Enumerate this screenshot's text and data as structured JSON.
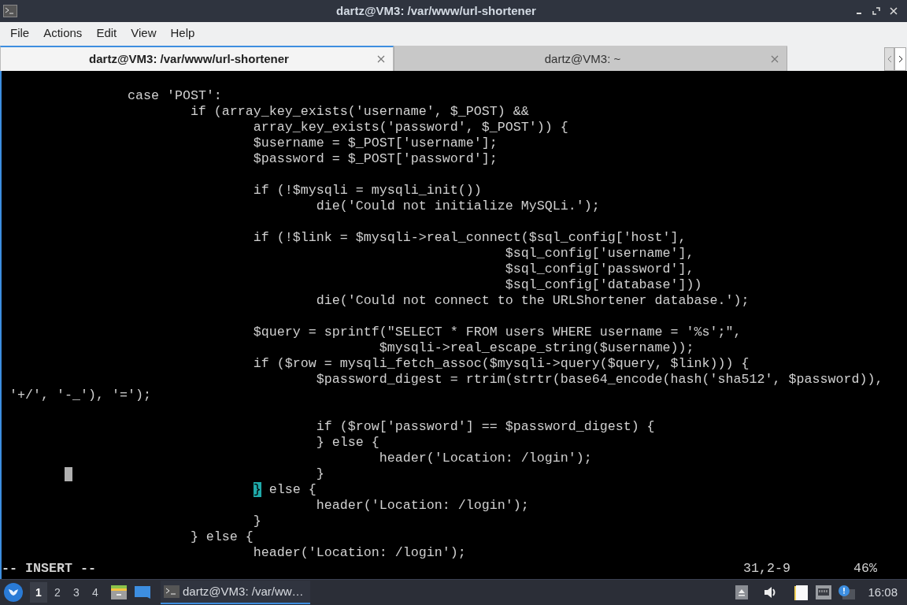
{
  "window": {
    "title": "dartz@VM3: /var/www/url-shortener"
  },
  "menu": [
    "File",
    "Actions",
    "Edit",
    "View",
    "Help"
  ],
  "tabs": [
    {
      "label": "dartz@VM3: /var/www/url-shortener",
      "selected": true
    },
    {
      "label": "dartz@VM3: ~",
      "selected": false
    }
  ],
  "terminal": {
    "lines": [
      {
        "kind": "blank"
      },
      {
        "kind": "text",
        "text": "                case 'POST':"
      },
      {
        "kind": "text",
        "text": "                        if (array_key_exists('username', $_POST) &&"
      },
      {
        "kind": "text",
        "text": "                                array_key_exists('password', $_POST')) {"
      },
      {
        "kind": "text",
        "text": "                                $username = $_POST['username'];"
      },
      {
        "kind": "text",
        "text": "                                $password = $_POST['password'];"
      },
      {
        "kind": "blank"
      },
      {
        "kind": "text",
        "text": "                                if (!$mysqli = mysqli_init())"
      },
      {
        "kind": "text",
        "text": "                                        die('Could not initialize MySQLi.');"
      },
      {
        "kind": "blank"
      },
      {
        "kind": "text",
        "text": "                                if (!$link = $mysqli->real_connect($sql_config['host'],"
      },
      {
        "kind": "text",
        "text": "                                                                $sql_config['username'],"
      },
      {
        "kind": "text",
        "text": "                                                                $sql_config['password'],"
      },
      {
        "kind": "text",
        "text": "                                                                $sql_config['database']))"
      },
      {
        "kind": "text",
        "text": "                                        die('Could not connect to the URLShortener database.');"
      },
      {
        "kind": "blank"
      },
      {
        "kind": "text",
        "text": "                                $query = sprintf(\"SELECT * FROM users WHERE username = '%s';\","
      },
      {
        "kind": "text",
        "text": "                                                $mysqli->real_escape_string($username));"
      },
      {
        "kind": "text",
        "text": "                                if ($row = mysqli_fetch_assoc($mysqli->query($query, $link))) {"
      },
      {
        "kind": "text",
        "text": "                                        $password_digest = rtrim(strtr(base64_encode(hash('sha512', $password)),"
      },
      {
        "kind": "text",
        "text": " '+/', '-_'), '=');"
      },
      {
        "kind": "blank"
      },
      {
        "kind": "text",
        "text": "                                        if ($row['password'] == $password_digest) {"
      },
      {
        "kind": "text",
        "text": "                                        } else {"
      },
      {
        "kind": "text",
        "text": "                                                header('Location: /login');"
      },
      {
        "kind": "text",
        "text": "                                        }",
        "cursor": true
      },
      {
        "kind": "text",
        "text": "                                } else {",
        "bracket_match": true
      },
      {
        "kind": "text",
        "text": "                                        header('Location: /login');"
      },
      {
        "kind": "text",
        "text": "                                }"
      },
      {
        "kind": "text",
        "text": "                        } else {"
      },
      {
        "kind": "text",
        "text": "                                header('Location: /login');"
      }
    ],
    "status": {
      "mode": "-- INSERT --",
      "position": "31,2-9",
      "percent": "46%"
    }
  },
  "taskbar": {
    "workspaces": [
      {
        "label": "1",
        "selected": true
      },
      {
        "label": "2",
        "selected": false
      },
      {
        "label": "3",
        "selected": false
      },
      {
        "label": "4",
        "selected": false
      }
    ],
    "task": "dartz@VM3: /var/ww…",
    "clock": "16:08"
  }
}
